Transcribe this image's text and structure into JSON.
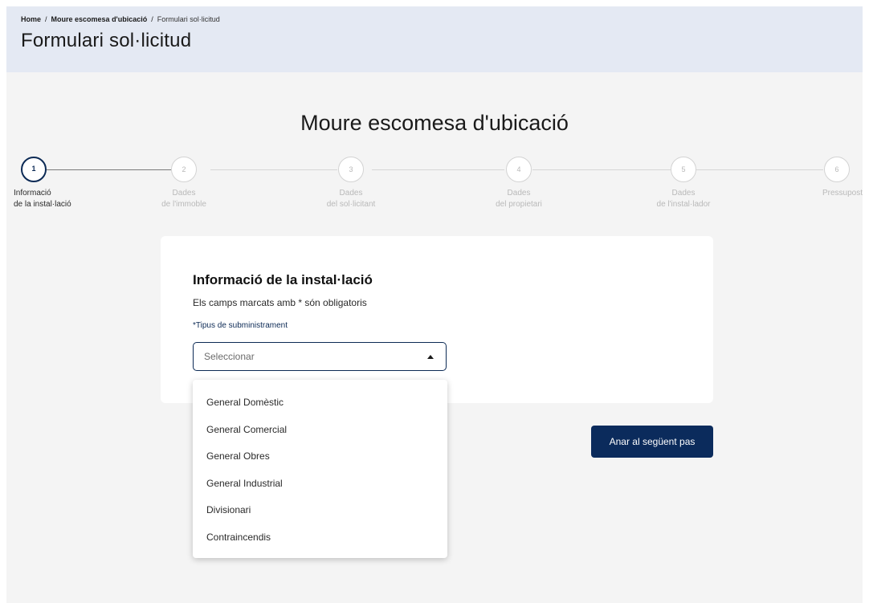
{
  "breadcrumb": {
    "items": [
      "Home",
      "Moure escomesa d'ubicació",
      "Formulari sol·licitud"
    ],
    "separator": "/"
  },
  "header": {
    "title": "Formulari sol·licitud"
  },
  "form": {
    "heading": "Moure escomesa d'ubicació"
  },
  "stepper": {
    "active_step": 1,
    "steps": [
      {
        "number": "1",
        "label_line1": "Informació",
        "label_line2": "de la instal·lació"
      },
      {
        "number": "2",
        "label_line1": "Dades",
        "label_line2": "de l'immoble"
      },
      {
        "number": "3",
        "label_line1": "Dades",
        "label_line2": "del sol·licitant"
      },
      {
        "number": "4",
        "label_line1": "Dades",
        "label_line2": "del propietari"
      },
      {
        "number": "5",
        "label_line1": "Dades",
        "label_line2": "de l'instal·lador"
      },
      {
        "number": "6",
        "label_line1": "Pressupost",
        "label_line2": ""
      }
    ]
  },
  "card": {
    "title": "Informació de la instal·lació",
    "subtitle": "Els camps marcats amb * són obligatoris",
    "field_label": "*Tipus de subministrament",
    "select_placeholder": "Seleccionar",
    "options": [
      "General Domèstic",
      "General Comercial",
      "General Obres",
      "General Industrial",
      "Divisionari",
      "Contraincendis"
    ]
  },
  "actions": {
    "next_label": "Anar al següent pas"
  },
  "colors": {
    "primary": "#0b2b5c",
    "header_bg": "#e4e9f3",
    "page_bg": "#f4f4f4",
    "inactive": "#b9b9b9"
  }
}
